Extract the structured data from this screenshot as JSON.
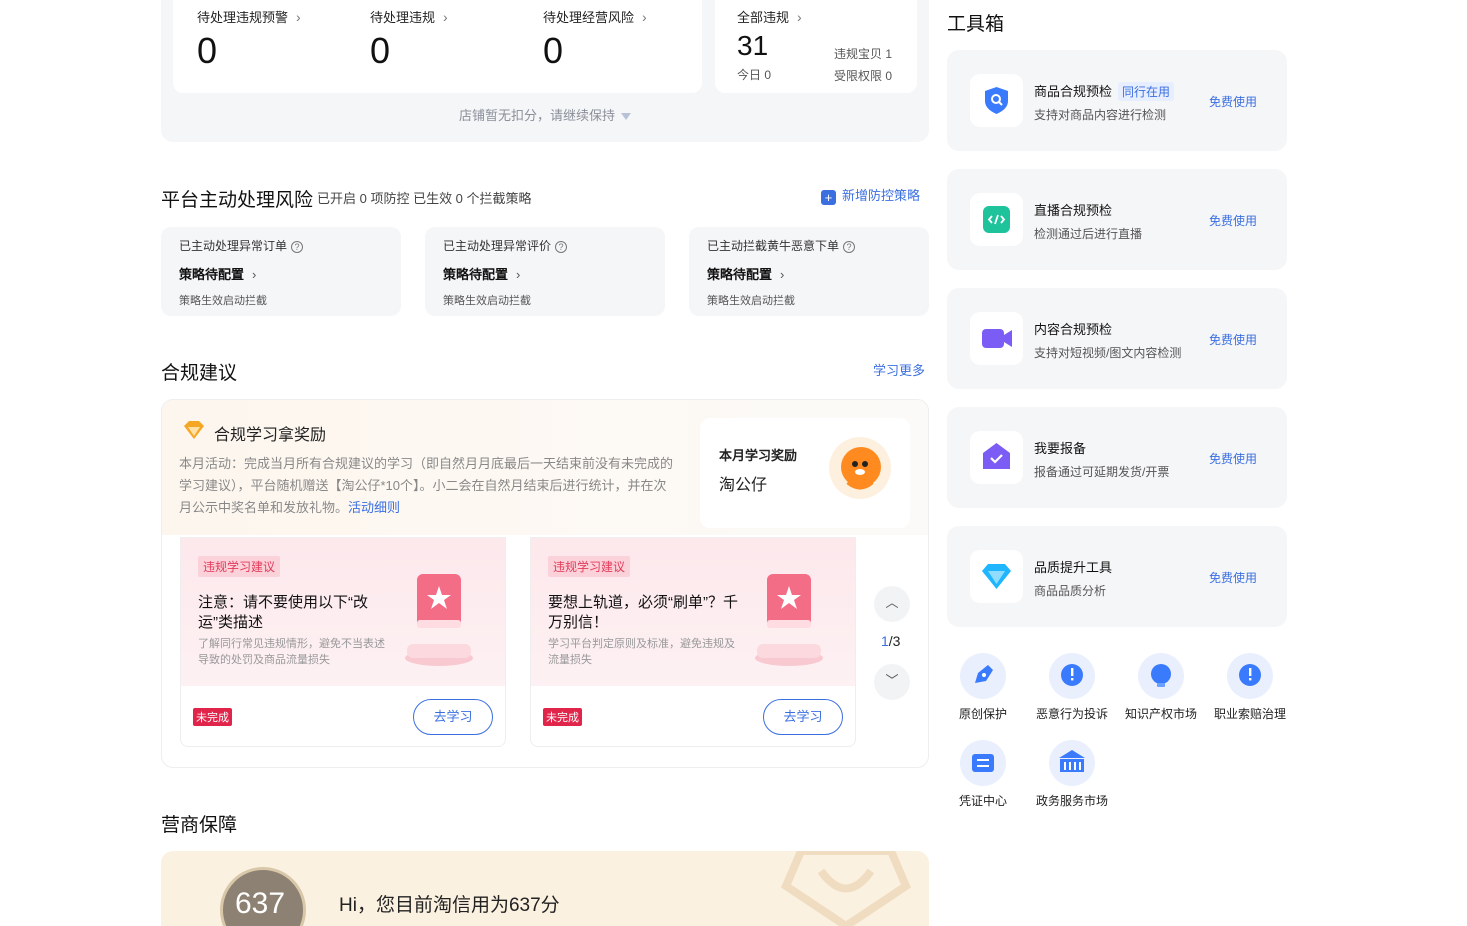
{
  "stats": {
    "warning": {
      "label": "待处理违规预警",
      "value": "0"
    },
    "violation": {
      "label": "待处理违规",
      "value": "0"
    },
    "risk": {
      "label": "待处理经营风险",
      "value": "0"
    },
    "all": {
      "label": "全部违规",
      "value": "31",
      "today": "今日 0",
      "baby": "违规宝贝 1",
      "limited": "受限权限 0"
    },
    "discount_note": "店铺暂无扣分，请继续保持"
  },
  "platform_risk": {
    "title": "平台主动处理风险",
    "summary": "已开启 0 项防控 已生效 0 个拦截策略",
    "add_link": "新增防控策略",
    "cards": [
      {
        "title": "已主动处理异常订单",
        "status": "策略待配置",
        "desc": "策略生效启动拦截"
      },
      {
        "title": "已主动处理异常评价",
        "status": "策略待配置",
        "desc": "策略生效启动拦截"
      },
      {
        "title": "已主动拦截黄牛恶意下单",
        "status": "策略待配置",
        "desc": "策略生效启动拦截"
      }
    ]
  },
  "compliance": {
    "title": "合规建议",
    "more": "学习更多",
    "reward_title": "合规学习拿奖励",
    "desc": "本月活动：完成当月所有合规建议的学习（即自然月月底最后一天结束前没有未完成的学习建议），平台随机赠送【淘公仔*10个】。小二会在自然月结束后进行统计，并在次月公示中奖名单和发放礼物。",
    "desc_link": "活动细则",
    "reward_box_title": "本月学习奖励",
    "reward_box_name": "淘公仔",
    "cards": [
      {
        "tag": "违规学习建议",
        "title": "注意：请不要使用以下“改运”类描述",
        "sub": "了解同行常见违规情形，避免不当表述导致的处罚及商品流量损失",
        "status": "未完成",
        "button": "去学习"
      },
      {
        "tag": "违规学习建议",
        "title": "要想上轨道，必须“刷单”？千万别信！",
        "sub": "学习平台判定原则及标准，避免违规及流量损失",
        "status": "未完成",
        "button": "去学习"
      }
    ],
    "pager_current": "1",
    "pager_total": "/3"
  },
  "guarantee": {
    "title": "营商保障",
    "score": "637",
    "hi": "Hi，您目前淘信用为637分"
  },
  "toolbox": {
    "title": "工具箱",
    "tools": [
      {
        "name": "商品合规预检",
        "tag": "同行在用",
        "desc": "支持对商品内容进行检测",
        "link": "免费使用",
        "icon": "shield-search-icon"
      },
      {
        "name": "直播合规预检",
        "tag": "",
        "desc": "检测通过后进行直播",
        "link": "免费使用",
        "icon": "code-icon"
      },
      {
        "name": "内容合规预检",
        "tag": "",
        "desc": "支持对短视频/图文内容检测",
        "link": "免费使用",
        "icon": "video-icon"
      },
      {
        "name": "我要报备",
        "tag": "",
        "desc": "报备通过可延期发货/开票",
        "link": "免费使用",
        "icon": "report-check-icon"
      },
      {
        "name": "品质提升工具",
        "tag": "",
        "desc": "商品品质分析",
        "link": "免费使用",
        "icon": "diamond-icon"
      }
    ],
    "mini_tools": [
      {
        "label": "原创保护",
        "icon": "pen-shield-icon"
      },
      {
        "label": "恶意行为投诉",
        "icon": "alert-bubble-icon"
      },
      {
        "label": "知识产权市场",
        "icon": "bulb-icon"
      },
      {
        "label": "职业索赔治理",
        "icon": "alert-bubble-icon"
      },
      {
        "label": "凭证中心",
        "icon": "ticket-icon"
      },
      {
        "label": "政务服务市场",
        "icon": "government-icon"
      }
    ]
  }
}
